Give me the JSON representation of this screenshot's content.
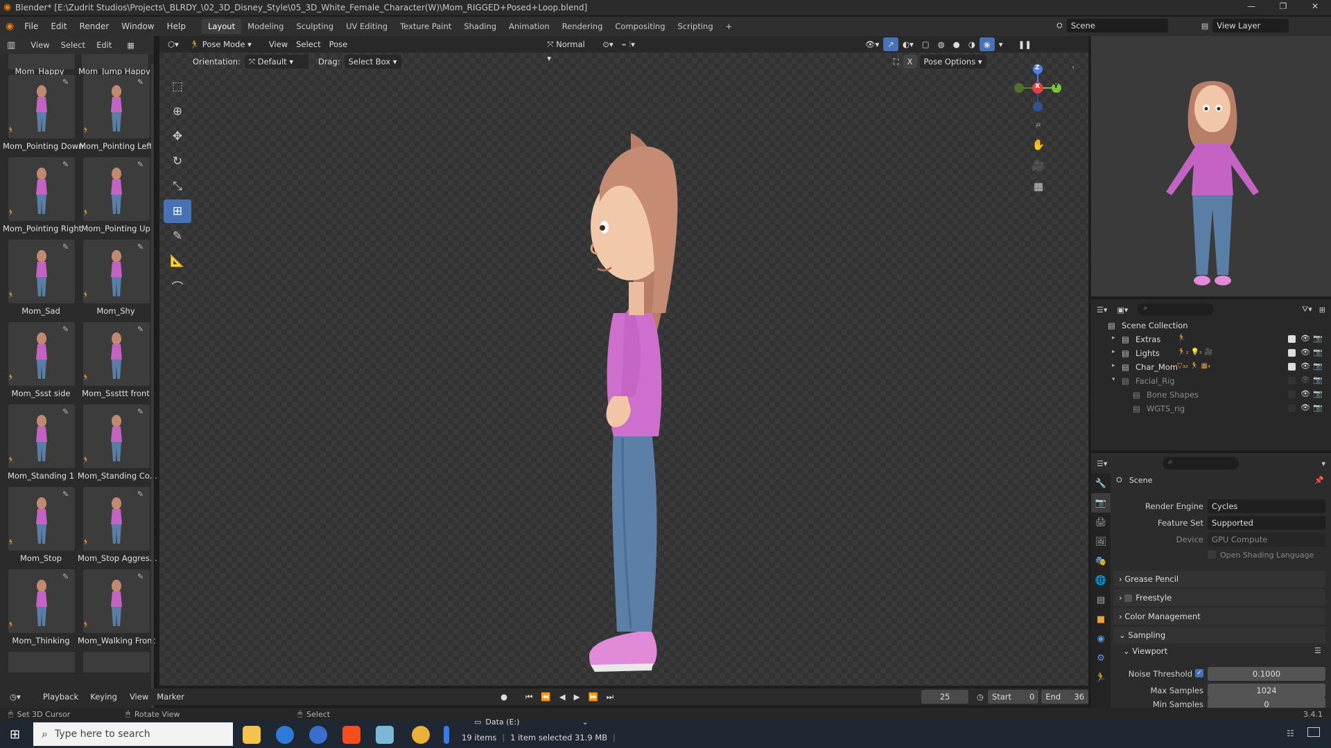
{
  "titlebar": {
    "title": "Blender* [E:\\Zudrit Studios\\Projects\\_BLRDY_\\02_3D_Disney_Style\\05_3D_White_Female_Character(W)\\Mom_RIGGED+Posed+Loop.blend]",
    "minimize": "—",
    "maximize": "❐",
    "close": "✕"
  },
  "menubar": {
    "items": [
      "File",
      "Edit",
      "Render",
      "Window",
      "Help"
    ],
    "workspaces": [
      "Layout",
      "Modeling",
      "Sculpting",
      "UV Editing",
      "Texture Paint",
      "Shading",
      "Animation",
      "Rendering",
      "Compositing",
      "Scripting"
    ],
    "add_tab": "+",
    "scene_label": "Scene",
    "view_layer_label": "View Layer"
  },
  "asset_panel": {
    "header": [
      "View",
      "Select",
      "Edit"
    ],
    "assets": [
      {
        "label": "Mom_Happy"
      },
      {
        "label": "Mom_Jump Happy"
      },
      {
        "label": "Mom_Pointing Down"
      },
      {
        "label": "Mom_Pointing Left"
      },
      {
        "label": "Mom_Pointing Right"
      },
      {
        "label": "Mom_Pointing Up"
      },
      {
        "label": "Mom_Sad"
      },
      {
        "label": "Mom_Shy"
      },
      {
        "label": "Mom_Ssst side"
      },
      {
        "label": "Mom_Sssttt front"
      },
      {
        "label": "Mom_Standing 1"
      },
      {
        "label": "Mom_Standing Co..."
      },
      {
        "label": "Mom_Stop"
      },
      {
        "label": "Mom_Stop Aggres..."
      },
      {
        "label": "Mom_Thinking"
      },
      {
        "label": "Mom_Walking Front"
      }
    ]
  },
  "viewport": {
    "mode": "Pose Mode",
    "menus": [
      "View",
      "Select",
      "Pose"
    ],
    "transform_orientation": "Normal",
    "orientation_label": "Orientation:",
    "orientation_value": "Default",
    "drag_label": "Drag:",
    "drag_value": "Select Box",
    "pose_options": "Pose Options",
    "gizmo": {
      "z": "Z",
      "x": "X",
      "y": "Y"
    }
  },
  "timeline": {
    "menus": [
      "Playback",
      "Keying",
      "View",
      "Marker"
    ],
    "current_frame": "25",
    "start_label": "Start",
    "start_value": "0",
    "end_label": "End",
    "end_value": "36"
  },
  "statusbar": {
    "left": "Set 3D Cursor",
    "middle": "Rotate View",
    "right": "Select",
    "version": "3.4.1"
  },
  "outliner": {
    "root": "Scene Collection",
    "rows": [
      {
        "name": "Extras",
        "extra": "🏃"
      },
      {
        "name": "Lights",
        "extra": "🏃₂ 💡₅ 🎥"
      },
      {
        "name": "Char_Mom",
        "extra": "▽₃₂ 🏃 ▦₄"
      },
      {
        "name": "Facial_Rig",
        "extra": ""
      },
      {
        "name": "Bone Shapes",
        "extra": ""
      },
      {
        "name": "WGTS_rig",
        "extra": ""
      }
    ]
  },
  "properties": {
    "scene_label": "Scene",
    "render_engine_label": "Render Engine",
    "render_engine": "Cycles",
    "feature_set_label": "Feature Set",
    "feature_set": "Supported",
    "device_label": "Device",
    "device": "GPU Compute",
    "osl_label": "Open Shading Language",
    "sections": [
      "Grease Pencil",
      "Freestyle",
      "Color Management",
      "Sampling"
    ],
    "viewport_label": "Viewport",
    "noise_threshold_label": "Noise Threshold",
    "noise_threshold": "0.1000",
    "max_samples_label": "Max Samples",
    "max_samples": "1024",
    "min_samples_label": "Min Samples",
    "min_samples": "0"
  },
  "taskbar": {
    "search_placeholder": "Type here to search",
    "drive_label": "Data (E:)",
    "items_count": "19 items",
    "selected": "1 item selected  31.9 MB"
  }
}
